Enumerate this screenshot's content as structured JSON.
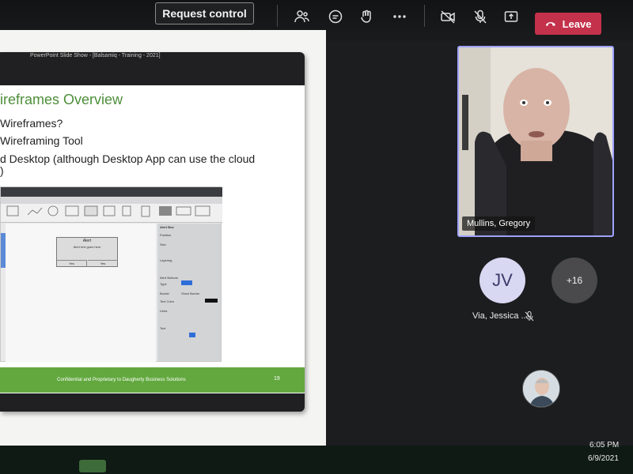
{
  "toolbar": {
    "request_control": "Request control",
    "leave": "Leave",
    "icons": [
      "people-icon",
      "chat-icon",
      "react-icon",
      "more-icon",
      "camera-off-icon",
      "mic-off-icon",
      "share-tray-icon"
    ]
  },
  "shared_screen": {
    "window_title": "PowerPoint Slide Show - [Balsamiq - Training - 2021]",
    "slide_title": "ireframes Overview",
    "bullets": [
      "Wireframes?",
      "Wireframing Tool",
      "d Desktop (although Desktop App can use the cloud",
      ")"
    ],
    "mockup": {
      "alert_title": "Alert",
      "alert_text": "Alert text goes here",
      "alert_yes_1": "Yes",
      "alert_yes_2": "Yes",
      "side_title": "Alert Box",
      "side_labels": [
        "Position",
        "Size",
        "Layering",
        "Alert Buttons",
        "Type",
        "Border",
        "Show Border",
        "Text Color",
        "Links",
        "Text"
      ]
    },
    "footer_text": "Confidential and Proprietary to Daugherty Business Solutions",
    "slide_number": "19"
  },
  "participants": {
    "featured_name": "Mullins, Gregory",
    "jv_initials": "JV",
    "jv_name": "Via, Jessica ...",
    "more_count": "+16"
  },
  "clock": {
    "time": "6:05 PM",
    "date": "6/9/2021"
  },
  "colors": {
    "leave_red": "#c4314b",
    "tile_border": "#9ea2ff",
    "slide_green": "#62a83e"
  }
}
